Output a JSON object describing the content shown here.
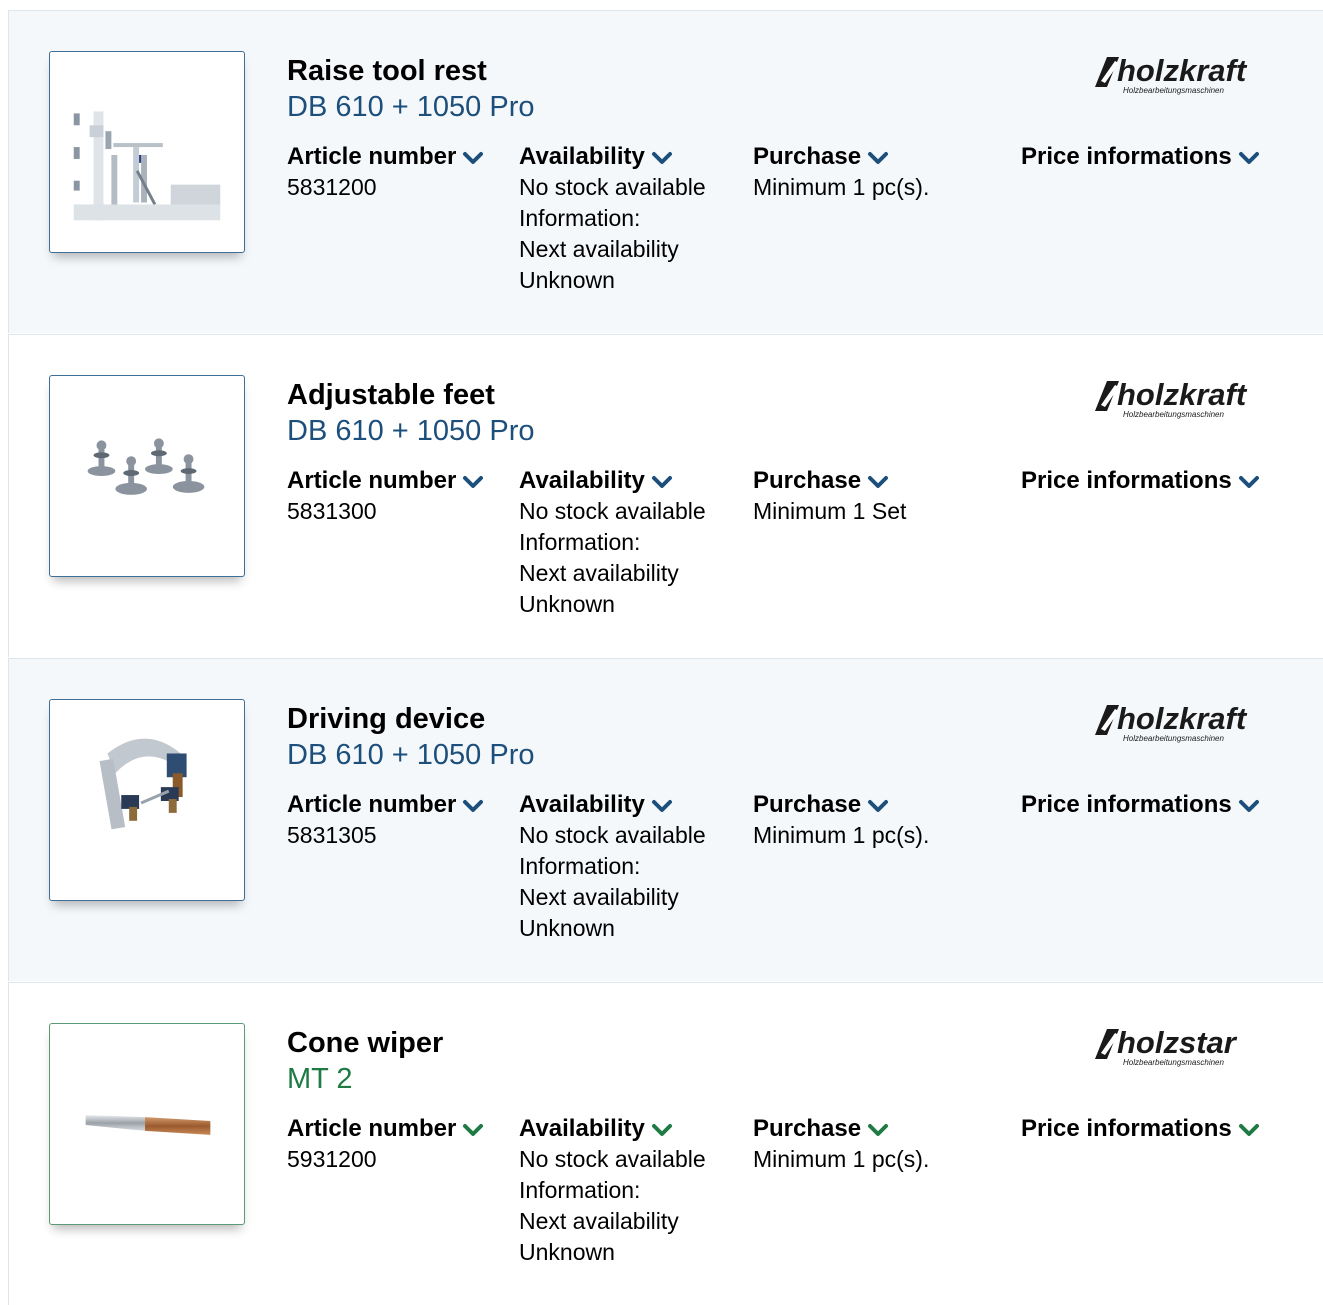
{
  "column_labels": {
    "article": "Article number",
    "availability": "Availability",
    "purchase": "Purchase",
    "price": "Price informations"
  },
  "accent_colors": {
    "blue": "#1d4f7c",
    "green": "#1f7a44"
  },
  "products": [
    {
      "title": "Raise tool rest",
      "model": "DB 610 + 1050 Pro",
      "article_number": "5831200",
      "availability": [
        "No stock available",
        "Information:",
        "Next availability",
        "Unknown"
      ],
      "purchase": "Minimum 1 pc(s).",
      "brand": "holzkraft",
      "brand_tagline": "Holzbearbeitungsmaschinen",
      "image_icon": "tool-rest-icon"
    },
    {
      "title": "Adjustable feet",
      "model": "DB 610 + 1050 Pro",
      "article_number": "5831300",
      "availability": [
        "No stock available",
        "Information:",
        "Next availability",
        "Unknown"
      ],
      "purchase": "Minimum 1 Set",
      "brand": "holzkraft",
      "brand_tagline": "Holzbearbeitungsmaschinen",
      "image_icon": "adjustable-feet-icon"
    },
    {
      "title": "Driving device",
      "model": "DB 610 + 1050 Pro",
      "article_number": "5831305",
      "availability": [
        "No stock available",
        "Information:",
        "Next availability",
        "Unknown"
      ],
      "purchase": "Minimum 1 pc(s).",
      "brand": "holzkraft",
      "brand_tagline": "Holzbearbeitungsmaschinen",
      "image_icon": "driving-device-icon"
    },
    {
      "title": "Cone wiper",
      "model": "MT 2",
      "article_number": "5931200",
      "availability": [
        "No stock available",
        "Information:",
        "Next availability",
        "Unknown"
      ],
      "purchase": "Minimum 1 pc(s).",
      "brand": "holzstar",
      "brand_tagline": "Holzbearbeitungsmaschinen",
      "image_icon": "cone-wiper-icon"
    }
  ]
}
